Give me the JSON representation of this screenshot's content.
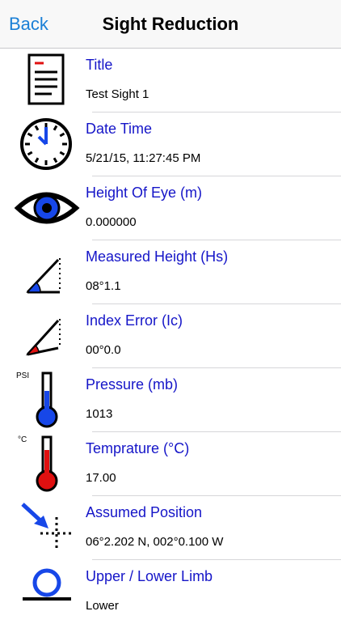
{
  "navbar": {
    "back_label": "Back",
    "title": "Sight Reduction"
  },
  "colors": {
    "accent": "#1a7fd6",
    "label": "#1515c8",
    "icon_blue": "#1747e8",
    "icon_red": "#e01010"
  },
  "rows": [
    {
      "icon": "document-icon",
      "label": "Title",
      "value": "Test Sight 1"
    },
    {
      "icon": "clock-icon",
      "label": "Date Time",
      "value": "5/21/15, 11:27:45 PM"
    },
    {
      "icon": "eye-icon",
      "label": "Height Of Eye (m)",
      "value": "0.000000"
    },
    {
      "icon": "sextant-angle-icon",
      "label": "Measured Height (Hs)",
      "value": "08°1.1"
    },
    {
      "icon": "index-error-icon",
      "label": "Index Error (Ic)",
      "value": "00°0.0"
    },
    {
      "icon": "pressure-thermometer-icon",
      "icon_text": "PSI",
      "label": "Pressure (mb)",
      "value": "1013"
    },
    {
      "icon": "temperature-thermometer-icon",
      "icon_text": "°C",
      "label": "Temprature (°C)",
      "value": "17.00"
    },
    {
      "icon": "position-arrow-icon",
      "label": "Assumed Position",
      "value": "06°2.202 N, 002°0.100 W"
    },
    {
      "icon": "limb-icon",
      "label": "Upper / Lower Limb",
      "value": "Lower"
    }
  ]
}
